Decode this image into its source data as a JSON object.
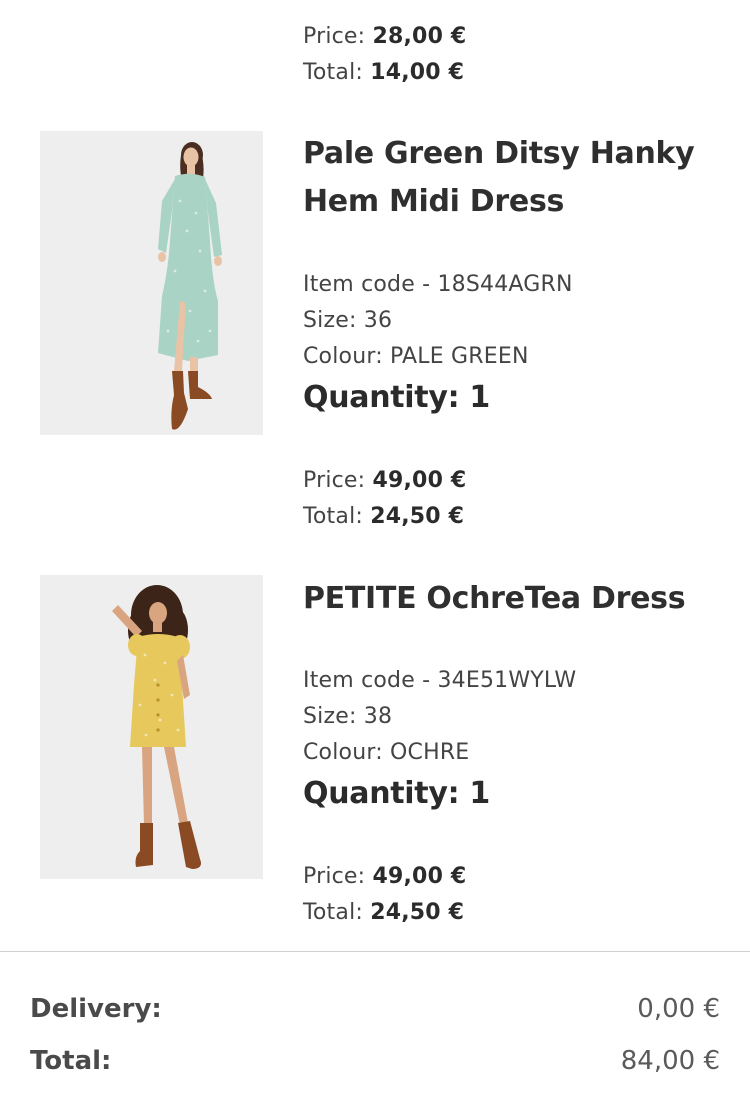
{
  "labels": {
    "price": "Price:",
    "total": "Total:"
  },
  "partial_item": {
    "price": "28,00 €",
    "total": "14,00 €"
  },
  "items": [
    {
      "name": "Pale Green Ditsy Hanky Hem Midi Dress",
      "item_code": "Item code - 18S44AGRN",
      "size": "Size: 36",
      "colour": "Colour: PALE GREEN",
      "quantity": "Quantity: 1",
      "price": "49,00 €",
      "total": "24,50 €"
    },
    {
      "name": "PETITE OchreTea Dress",
      "item_code": "Item code - 34E51WYLW",
      "size": "Size: 38",
      "colour": "Colour: OCHRE",
      "quantity": "Quantity: 1",
      "price": "49,00 €",
      "total": "24,50 €"
    }
  ],
  "summary": {
    "delivery_label": "Delivery:",
    "delivery_value": "0,00 €",
    "total_label": "Total:",
    "total_value": "84,00 €"
  },
  "colors": {
    "dress_green": "#a9d3c4",
    "dress_ochre": "#e6c85c",
    "boots": "#8a4a24",
    "thumb_bg": "#eeeeee"
  }
}
